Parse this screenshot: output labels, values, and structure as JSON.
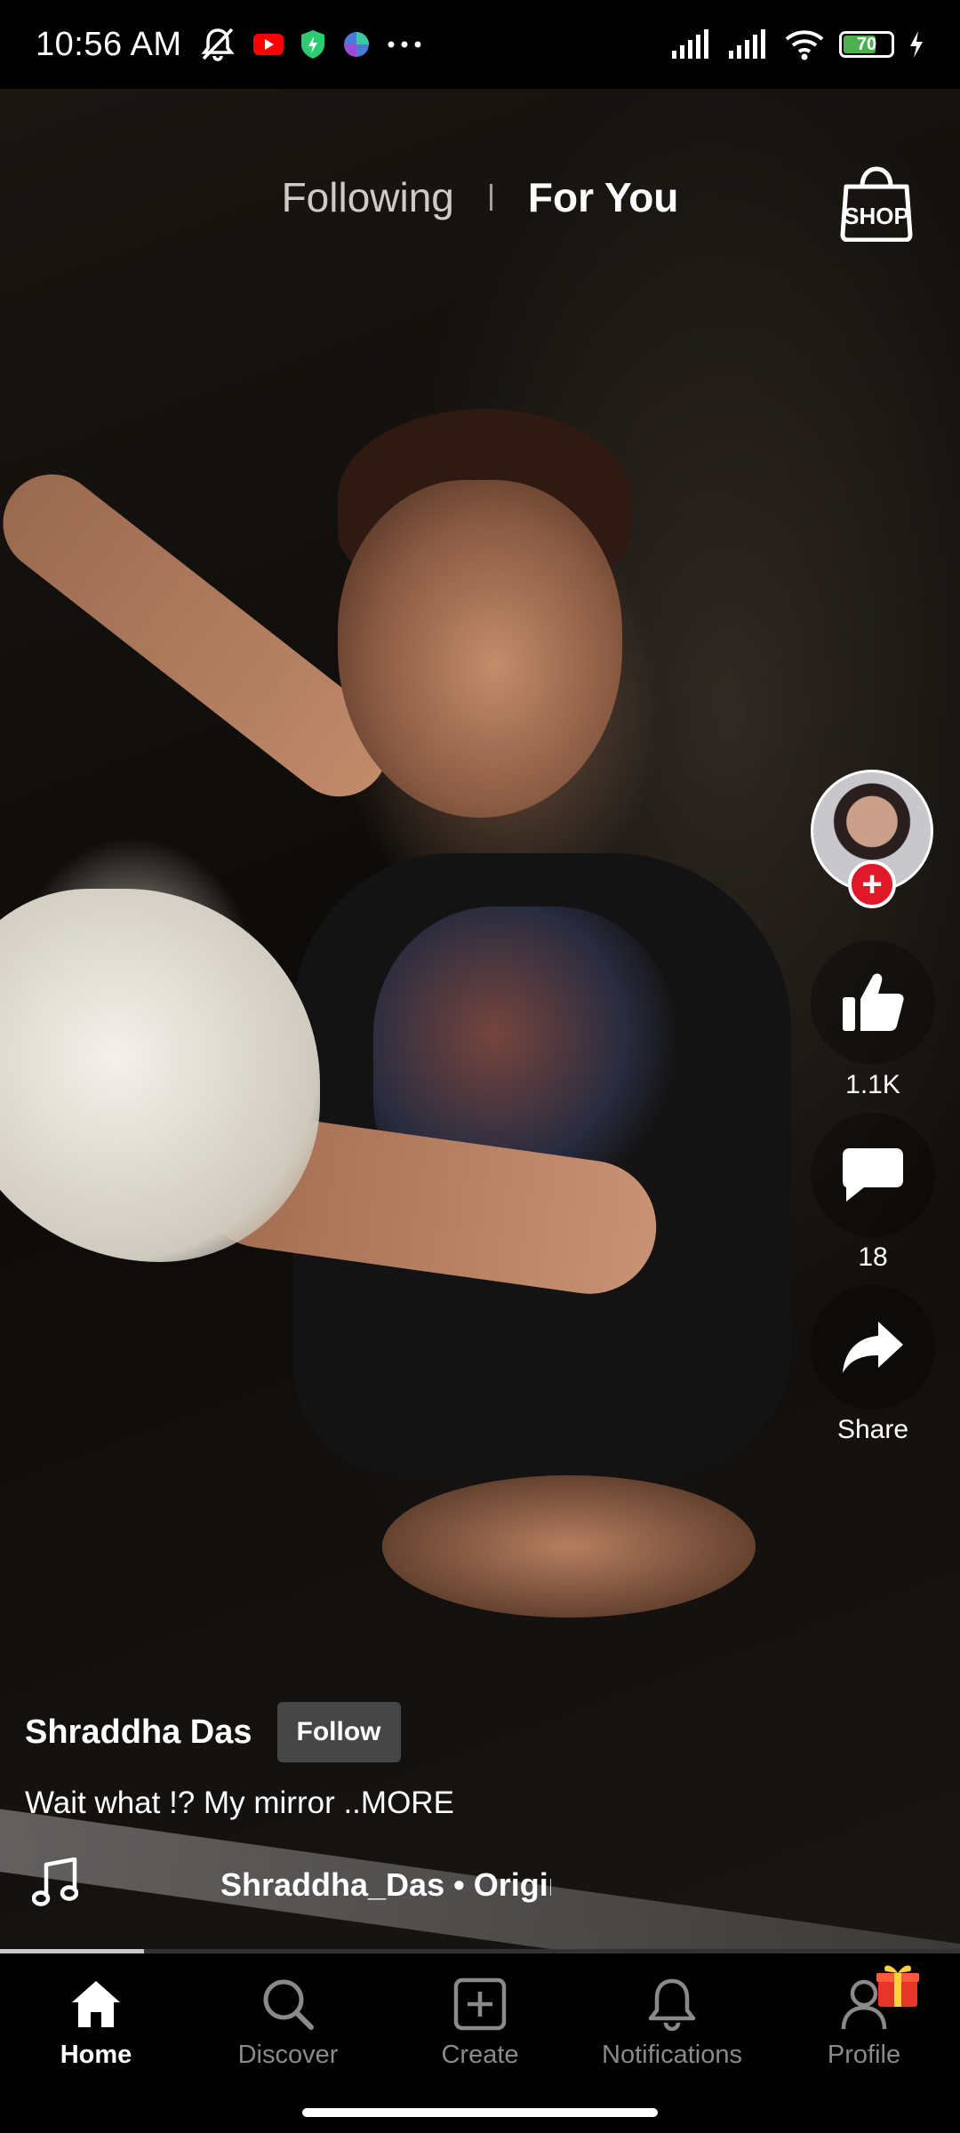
{
  "status_bar": {
    "time": "10:56 AM",
    "icons": [
      "mute-bell-icon",
      "youtube-icon",
      "shield-icon",
      "app-circle-icon",
      "more-dots-icon",
      "signal-icon",
      "signal-icon",
      "wifi-icon",
      "battery-icon",
      "charging-icon"
    ],
    "battery_level": "70"
  },
  "top_tabs": {
    "following": "Following",
    "for_you": "For You",
    "shop_label": "SHOP"
  },
  "rail": {
    "like_count": "1.1K",
    "comment_count": "18",
    "share_label": "Share",
    "follow_plus": "+"
  },
  "post": {
    "username": "Shraddha Das",
    "follow_label": "Follow",
    "caption": "Wait what !? My mirror ..MORE",
    "music_text": "Shraddha_Das • Original Sound"
  },
  "playback": {
    "progress": 0.15
  },
  "bottom_nav": {
    "items": [
      {
        "label": "Home",
        "icon": "home-icon",
        "active": true
      },
      {
        "label": "Discover",
        "icon": "search-icon",
        "active": false
      },
      {
        "label": "Create",
        "icon": "create-plus-icon",
        "active": false
      },
      {
        "label": "Notifications",
        "icon": "bell-icon",
        "active": false
      },
      {
        "label": "Profile",
        "icon": "profile-icon",
        "active": false
      }
    ]
  },
  "colors": {
    "follow_red": "#e0192a",
    "battery_green": "#4caf50",
    "inactive_nav": "#8a8a8a"
  }
}
